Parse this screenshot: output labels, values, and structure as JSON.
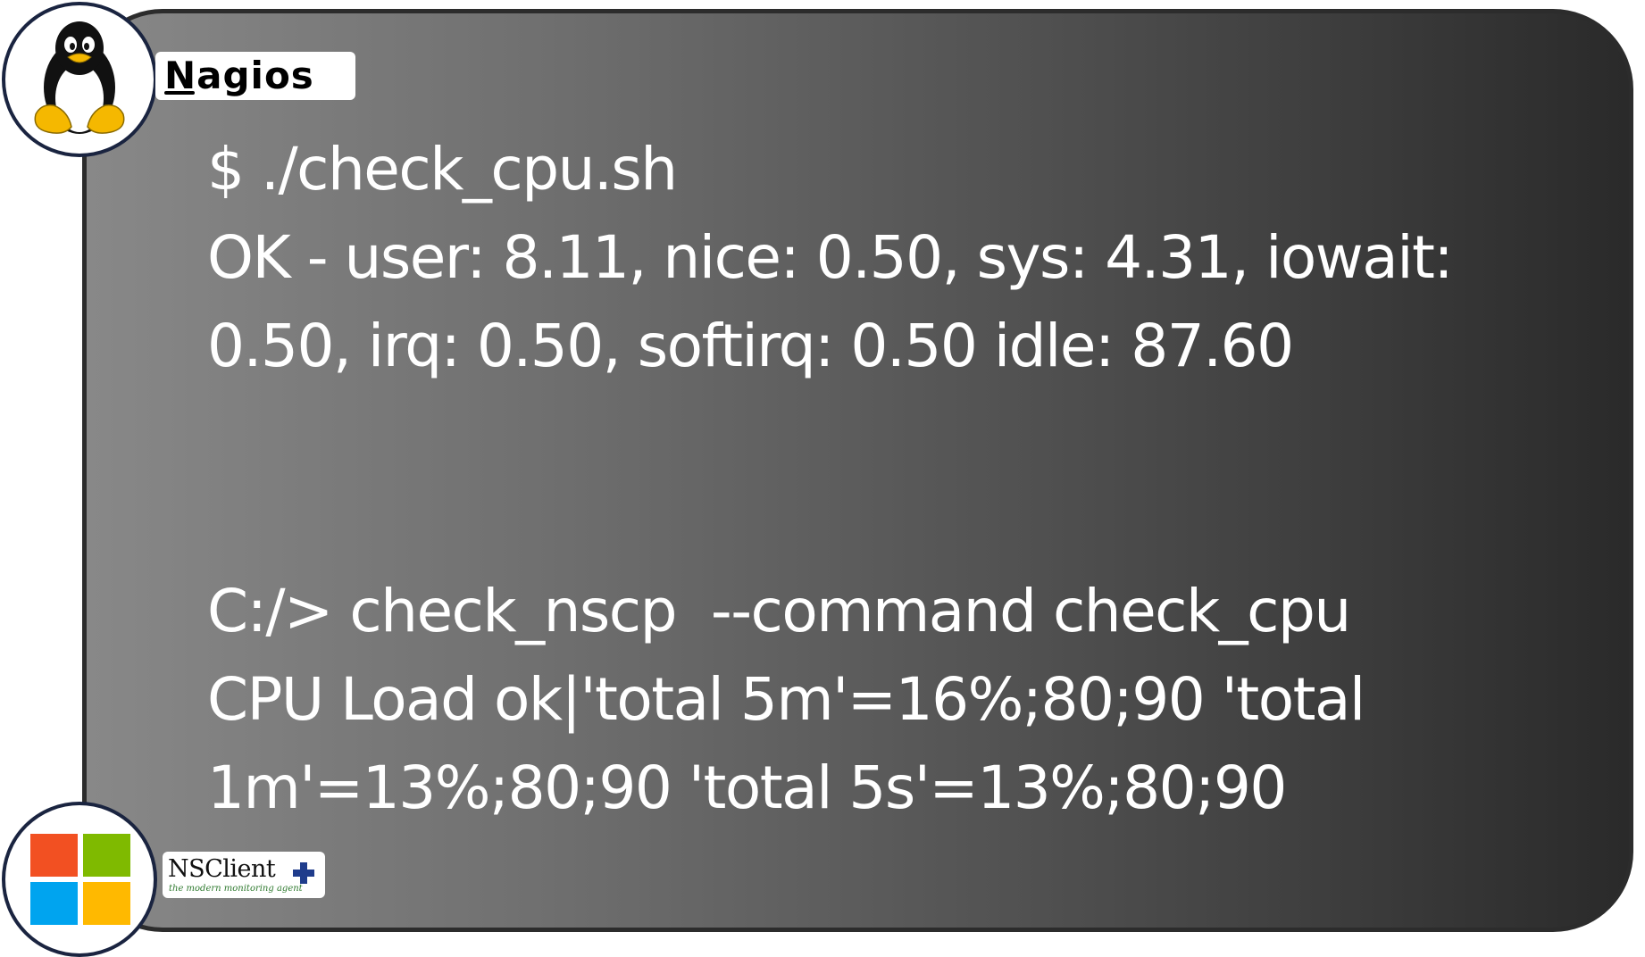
{
  "terminal": {
    "linux": {
      "command": "$ ./check_cpu.sh",
      "output_line_1": "OK - user: 8.11, nice: 0.50, sys: 4.31, iowait:",
      "output_line_2": "0.50, irq: 0.50, softirq: 0.50 idle: 87.60"
    },
    "windows": {
      "command": "C:/> check_nscp  --command check_cpu",
      "output_line_1": "CPU Load ok|'total 5m'=16%;80;90 'total",
      "output_line_2": "1m'=13%;80;90 'total 5s'=13%;80;90"
    }
  },
  "badges": {
    "linux": {
      "icon": "tux-penguin-icon",
      "label": "Nagios"
    },
    "windows": {
      "icon": "windows-logo-icon",
      "label": "NSClient",
      "tagline": "the modern monitoring agent",
      "plus_icon": "plus-icon"
    }
  },
  "colors": {
    "panel_gradient_left": "#888888",
    "panel_gradient_right": "#2a2a2a",
    "panel_border": "#2c2c2c",
    "text": "#ffffff",
    "win_red": "#f25022",
    "win_green": "#7fba00",
    "win_blue": "#00a4ef",
    "win_yellow": "#ffb900",
    "nsclient_plus": "#1f3c8c"
  }
}
